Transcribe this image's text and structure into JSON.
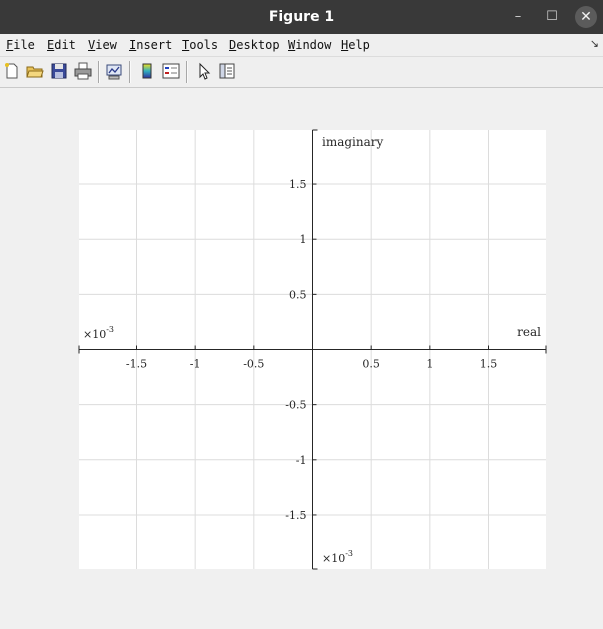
{
  "window": {
    "title": "Figure 1",
    "minimize_glyph": "–",
    "maximize_glyph": "☐",
    "close_glyph": "✕"
  },
  "menubar": {
    "items": [
      {
        "key": "F",
        "rest": "ile"
      },
      {
        "key": "E",
        "rest": "dit"
      },
      {
        "key": "V",
        "rest": "iew"
      },
      {
        "key": "I",
        "rest": "nsert"
      },
      {
        "key": "T",
        "rest": "ools"
      },
      {
        "key": "D",
        "rest": "esktop"
      },
      {
        "key": "W",
        "rest": "indow"
      },
      {
        "key": "H",
        "rest": "elp"
      }
    ],
    "overflow_glyph": "↘"
  },
  "toolbar": {
    "buttons": [
      "new-figure-icon",
      "open-file-icon",
      "save-icon",
      "print-icon",
      "link-plot-icon",
      "colorbar-icon",
      "legend-icon",
      "pointer-icon",
      "property-editor-icon"
    ]
  },
  "colors": {
    "titlebar": "#393939",
    "window_bg": "#f0f0f0",
    "axes_bg": "#ffffff",
    "grid": "#dcdcdc",
    "axis": "#262626"
  },
  "chart_data": {
    "type": "scatter",
    "series": [],
    "x_ticks": [
      "-1.5",
      "-1",
      "-0.5",
      "0.5",
      "1",
      "1.5"
    ],
    "x_tick_values": [
      -1.5,
      -1,
      -0.5,
      0.5,
      1,
      1.5
    ],
    "y_ticks": [
      "1.5",
      "1",
      "0.5",
      "-0.5",
      "-1",
      "-1.5"
    ],
    "y_tick_values": [
      1.5,
      1,
      0.5,
      -0.5,
      -1,
      -1.5
    ],
    "xlim": [
      -1.99,
      1.99
    ],
    "ylim": [
      -1.99,
      1.99
    ],
    "xlabel": "real",
    "ylabel": "imaginary",
    "x_exponent": "×10",
    "x_exponent_power": "-3",
    "y_exponent": "×10",
    "y_exponent_power": "-3",
    "grid": true,
    "axis_location": "origin"
  }
}
